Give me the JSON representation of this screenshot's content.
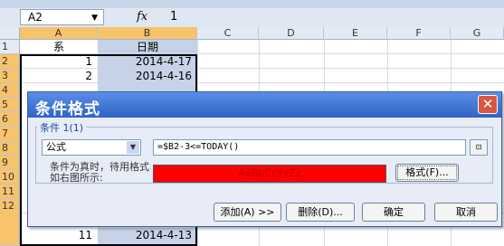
{
  "formula_bar": {
    "name_box": "A2",
    "fx": "fx",
    "value": "1"
  },
  "columns": [
    "A",
    "B",
    "C",
    "D",
    "E",
    "F",
    "G"
  ],
  "rows": [
    "1",
    "2",
    "3",
    "4",
    "5",
    "6",
    "7",
    "8",
    "9",
    "10",
    "11",
    "12"
  ],
  "cells": {
    "header_a": "系",
    "header_b": "日期",
    "r2": {
      "a": "1",
      "b": "2014-4-17"
    },
    "r3": {
      "a": "2",
      "b": "2014-4-16"
    },
    "r12": {
      "a": "11",
      "b": "2014-4-13"
    }
  },
  "dialog": {
    "title": "条件格式",
    "close": "✕",
    "condition_label": "条件 1(1)",
    "condition_type": "公式",
    "formula": "=$B2-3<=TODAY()",
    "collapse_icon": "⊡",
    "preview_caption": "条件为真时，待用格式如右图所示:",
    "preview_text": "AaBbCcYyZz",
    "format_button": "格式(F)...",
    "add_button": "添加(A) >>",
    "delete_button": "删除(D)...",
    "ok_button": "确定",
    "cancel_button": "取消"
  },
  "colors": {
    "preview_fill": "#ff0000",
    "title_bar": "#2f63c8",
    "selected_header": "#f7c36b"
  }
}
